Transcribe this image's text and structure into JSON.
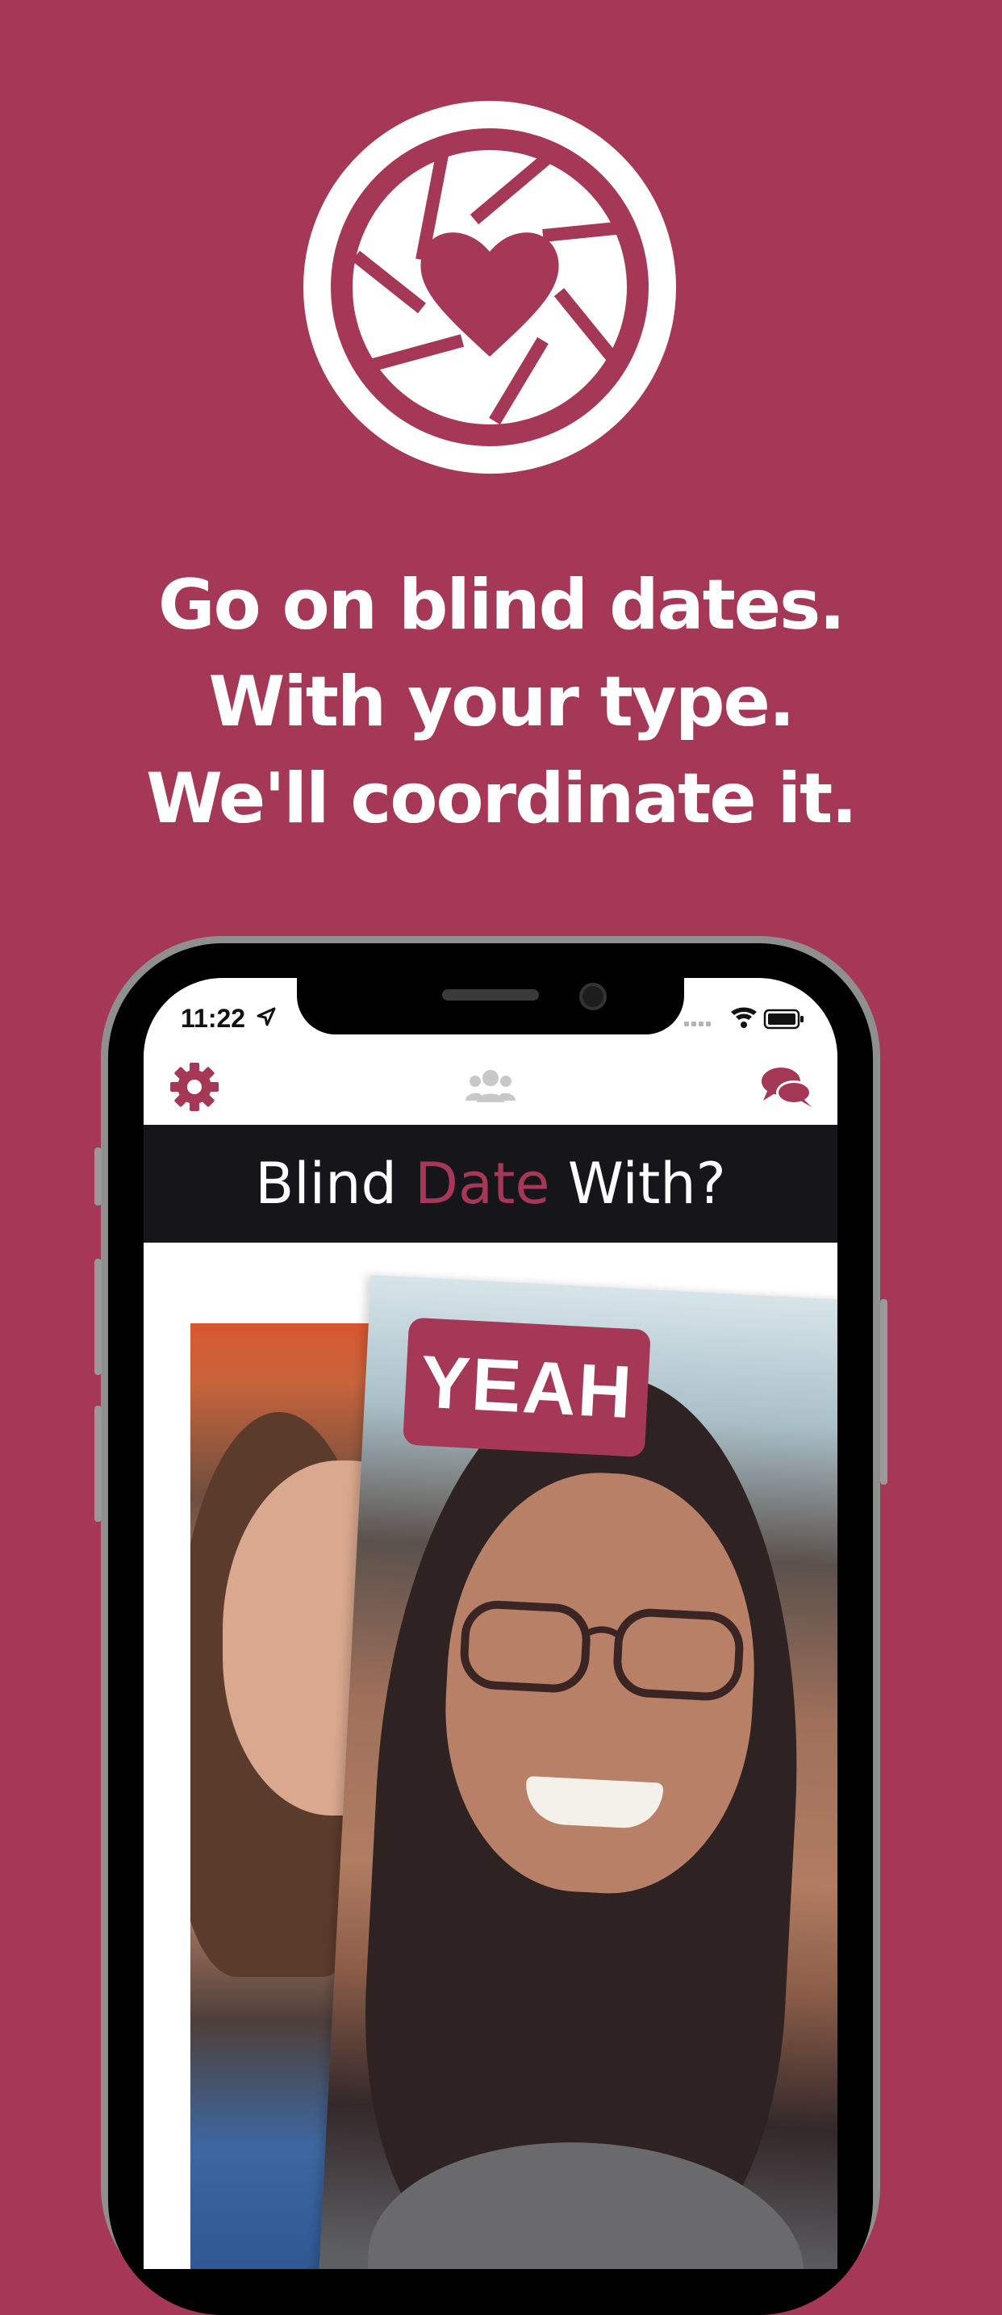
{
  "colors": {
    "brand": "#A53857",
    "dark": "#15151A",
    "white": "#FFFFFF"
  },
  "logo": {
    "icon": "camera-aperture-heart-icon"
  },
  "headline": {
    "line1": "Go on blind dates.",
    "line2": "With your type.",
    "line3": "We'll coordinate it."
  },
  "status_bar": {
    "time": "11:22"
  },
  "app_bar": {
    "left_icon": "gear-icon",
    "center_icon": "group-icon",
    "right_icon": "chat-bubbles-icon"
  },
  "title": {
    "part1": "Blind ",
    "accent": "Date",
    "part2": " With?"
  },
  "card": {
    "badge": "YEAH"
  }
}
